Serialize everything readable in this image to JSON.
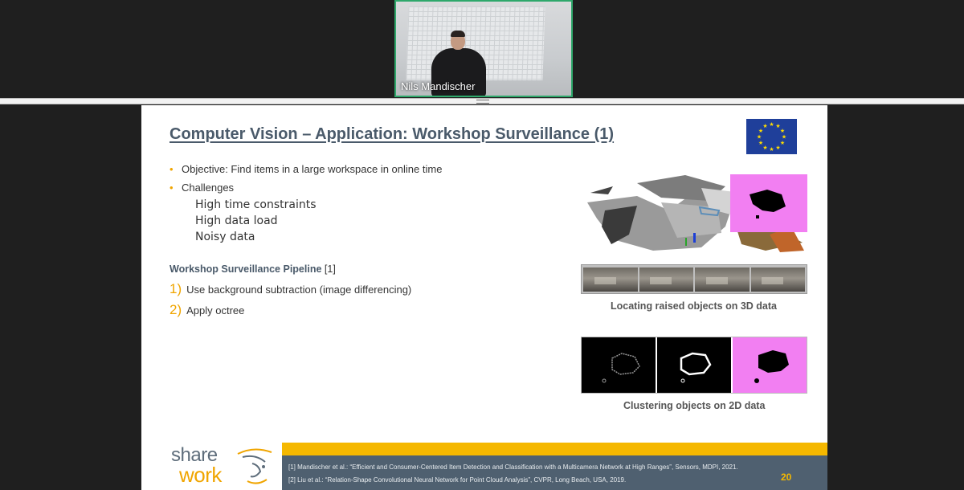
{
  "participant": {
    "name": "Nils Mandischer"
  },
  "slide": {
    "title": "Computer Vision – Application: Workshop Surveillance (1)",
    "bullets": [
      {
        "marker": "•",
        "text": "Objective: Find items in a large workspace in online time"
      },
      {
        "marker": "•",
        "text": "Challenges"
      }
    ],
    "challenges": [
      "High time constraints",
      "High data load",
      "Noisy data"
    ],
    "pipeline_title": "Workshop Surveillance Pipeline",
    "pipeline_ref": "[1]",
    "steps": [
      {
        "num": "1)",
        "text": "Use background subtraction (image differencing)"
      },
      {
        "num": "2)",
        "text": "Apply octree"
      }
    ],
    "caption_3d": "Locating raised objects on 3D data",
    "caption_2d": "Clustering objects on 2D data",
    "references": [
      "[1] Mandischer et al.: “Efficient and Consumer-Centered Item Detection and Classification with a Multicamera Network at High Ranges”, Sensors, MDPI, 2021.",
      "[2] Liu et al.: “Relation-Shape Convolutional Neural Network for Point Cloud Analysis”, CVPR, Long Beach, USA, 2019."
    ],
    "page_number": "20",
    "logo": {
      "line1": "share",
      "line2": "work"
    }
  },
  "colors": {
    "accent": "#f0a500",
    "title": "#4a5a6a",
    "footer": "#4f6070",
    "video_border": "#2ea86b",
    "mask": "#f27ff2"
  }
}
